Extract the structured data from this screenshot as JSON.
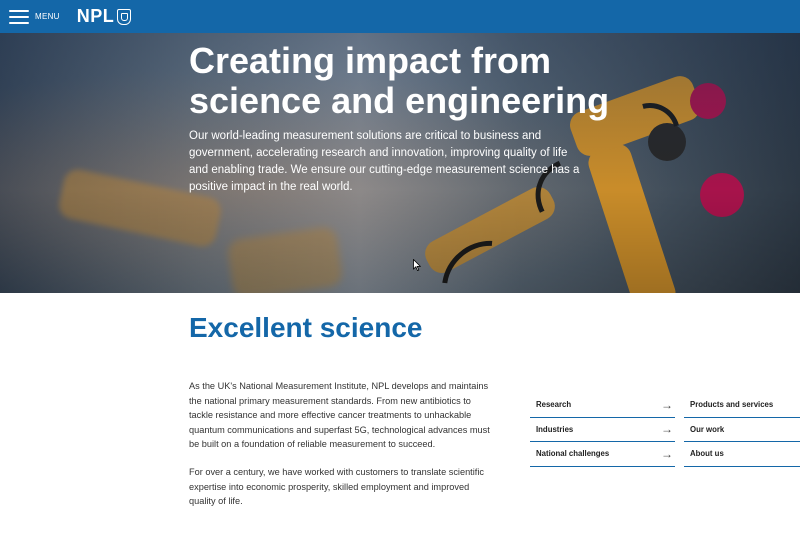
{
  "header": {
    "menu_label": "MENU",
    "logo_text": "NPL",
    "bar_color": "#1467a8"
  },
  "hero": {
    "title": "Creating impact from science and engineering",
    "subtitle": "Our world-leading measurement solutions are critical to business and government, accelerating research and innovation, improving quality of life and enabling trade. We ensure our cutting-edge measurement science has a positive impact in the real world."
  },
  "main": {
    "section_title": "Excellent science",
    "paragraph1": "As the UK's National Measurement Institute, NPL develops and maintains the national primary measurement standards. From new antibiotics to tackle resistance and more effective cancer treatments to unhackable quantum communications and superfast 5G, technological advances must be built on a foundation of reliable measurement to succeed.",
    "paragraph2": "For over a century, we have worked with customers to translate scientific expertise into economic prosperity, skilled employment and improved quality of life."
  },
  "links": {
    "left": [
      {
        "label": "Research",
        "icon": "arrow-right-icon"
      },
      {
        "label": "Industries",
        "icon": "arrow-right-icon"
      },
      {
        "label": "National challenges",
        "icon": "arrow-right-icon"
      }
    ],
    "right": [
      {
        "label": "Products and services"
      },
      {
        "label": "Our work"
      },
      {
        "label": "About us"
      }
    ]
  },
  "icons": {
    "arrow": "→"
  }
}
